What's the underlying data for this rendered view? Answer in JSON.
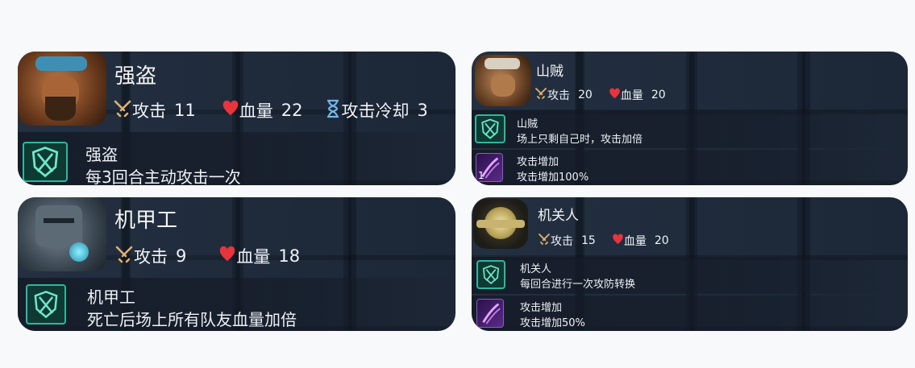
{
  "cards": [
    {
      "name": "强盗",
      "stats": {
        "attack_label": "攻击",
        "attack": "11",
        "hp_label": "血量",
        "hp": "22",
        "cooldown_label": "攻击冷却",
        "cooldown": "3"
      },
      "skill": {
        "title": "强盗",
        "desc": "每3回合主动攻击一次"
      }
    },
    {
      "name": "山贼",
      "stats": {
        "attack_label": "攻击",
        "attack": "20",
        "hp_label": "血量",
        "hp": "20"
      },
      "skill": {
        "title": "山贼",
        "desc": "场上只剩自己时，攻击加倍"
      },
      "buff": {
        "title": "攻击增加",
        "desc": "攻击增加100%",
        "count": "1"
      }
    },
    {
      "name": "机甲工",
      "stats": {
        "attack_label": "攻击",
        "attack": "9",
        "hp_label": "血量",
        "hp": "18"
      },
      "skill": {
        "title": "机甲工",
        "desc": "死亡后场上所有队友血量加倍"
      }
    },
    {
      "name": "机关人",
      "stats": {
        "attack_label": "攻击",
        "attack": "15",
        "hp_label": "血量",
        "hp": "20"
      },
      "skill": {
        "title": "机关人",
        "desc": "每回合进行一次攻防转换"
      },
      "buff": {
        "title": "攻击增加",
        "desc": "攻击增加50%"
      }
    }
  ],
  "colors": {
    "heart": "#e8343c",
    "sword": "#e0b070",
    "hourglass": "#6fb6e8",
    "skill_teal": "#2fb79a",
    "buff_purple": "#8a5cc0"
  },
  "icons": [
    "sword-icon",
    "heart-icon",
    "hourglass-icon",
    "shield-crossed-icon",
    "claw-slash-icon"
  ]
}
